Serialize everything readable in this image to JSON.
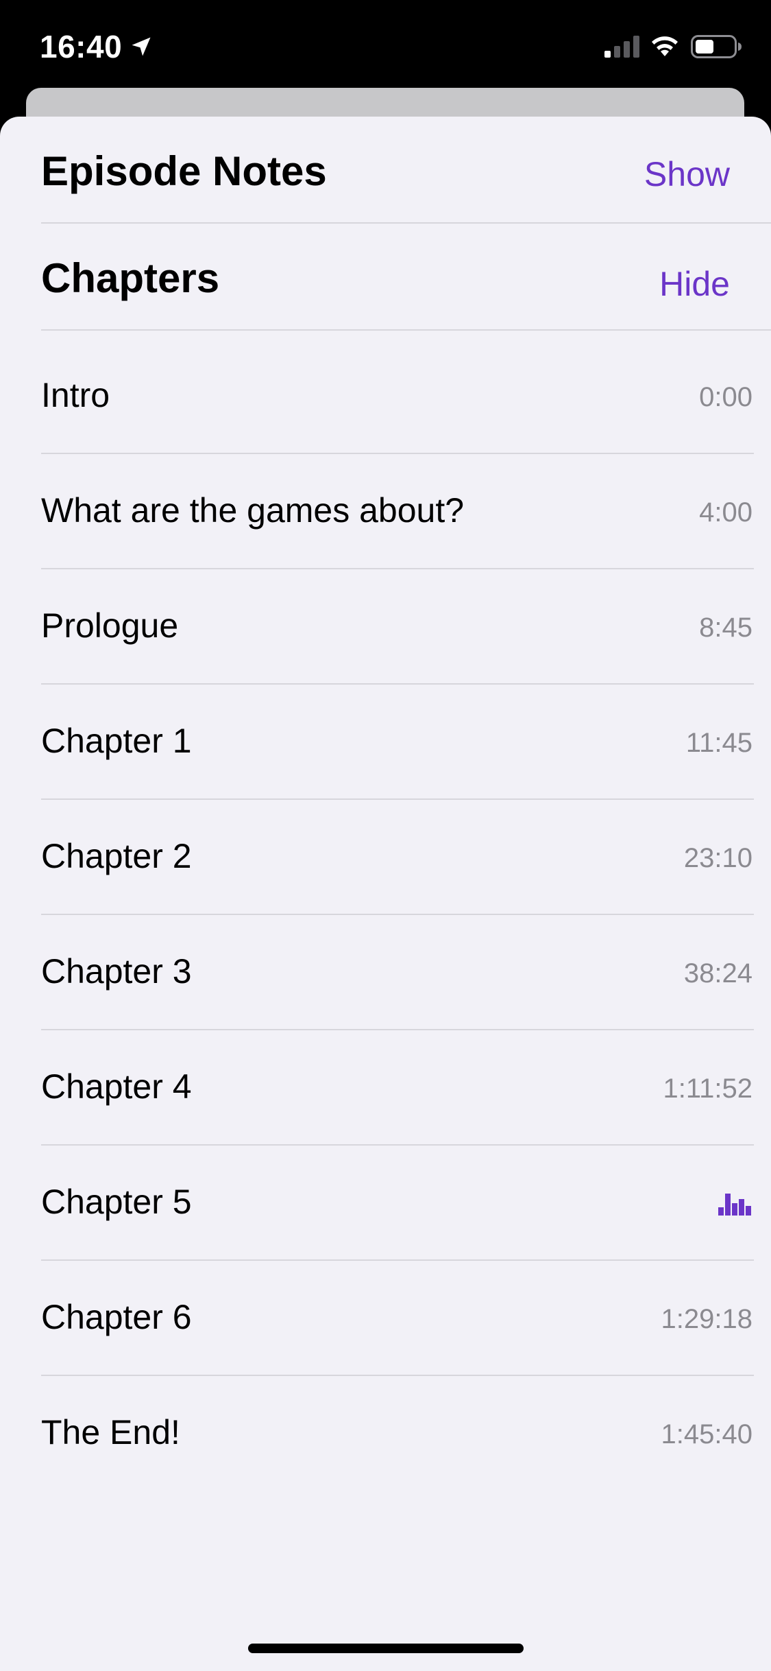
{
  "status_bar": {
    "time": "16:40",
    "icons": [
      "location-arrow-icon",
      "cellular-signal-icon",
      "wifi-icon",
      "battery-icon"
    ]
  },
  "episode_notes": {
    "title": "Episode Notes",
    "action": "Show"
  },
  "chapters": {
    "title": "Chapters",
    "action": "Hide",
    "items": [
      {
        "title": "Intro",
        "time": "0:00"
      },
      {
        "title": "What are the games about?",
        "time": "4:00"
      },
      {
        "title": "Prologue",
        "time": "8:45"
      },
      {
        "title": "Chapter 1",
        "time": "11:45"
      },
      {
        "title": "Chapter 2",
        "time": "23:10"
      },
      {
        "title": "Chapter 3",
        "time": "38:24"
      },
      {
        "title": "Chapter 4",
        "time": "1:11:52"
      },
      {
        "title": "Chapter 5",
        "time": null,
        "now_playing": true,
        "indicator_icon": "now-playing-bars-icon"
      },
      {
        "title": "Chapter 6",
        "time": "1:29:18"
      },
      {
        "title": "The End!",
        "time": "1:45:40"
      }
    ]
  },
  "colors": {
    "accent": "#6b35c8",
    "sheet_background": "#f2f1f7",
    "secondary_text": "#8b8a90",
    "separator": "#d7d6dc"
  }
}
